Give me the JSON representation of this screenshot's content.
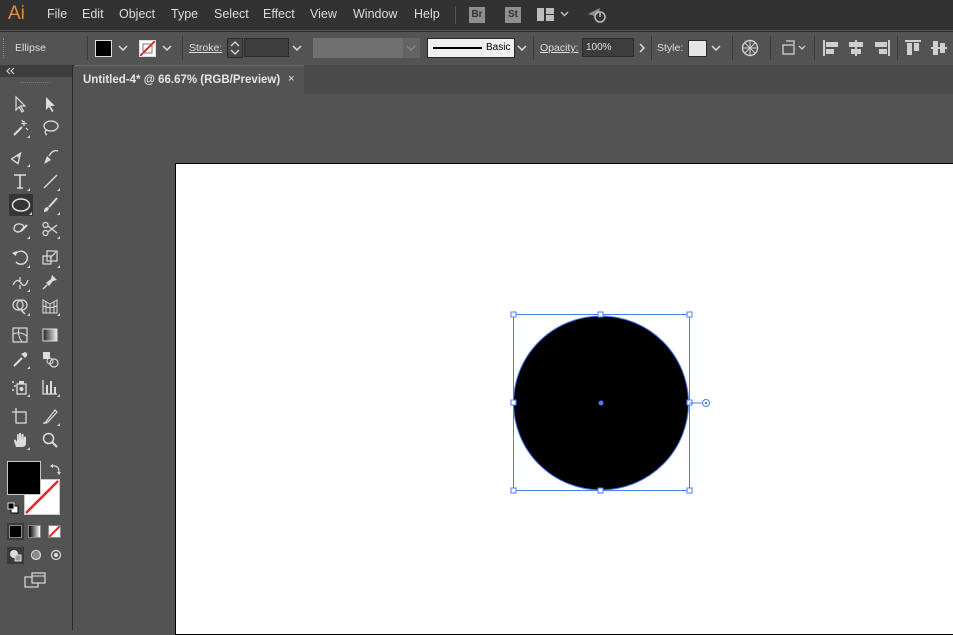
{
  "app": {
    "logo": "Ai"
  },
  "menu": [
    "File",
    "Edit",
    "Object",
    "Type",
    "Select",
    "Effect",
    "View",
    "Window",
    "Help"
  ],
  "app_buttons": {
    "bridge": "Br",
    "stock": "St"
  },
  "control_bar": {
    "object_type": "Ellipse",
    "stroke_label": "Stroke:",
    "brush_label": "Basic",
    "opacity_label": "Opacity:",
    "opacity_value": "100%",
    "style_label": "Style:"
  },
  "document_tab": {
    "title": "Untitled-4* @ 66.67% (RGB/Preview)",
    "close": "×"
  },
  "colors": {
    "selection": "#4b7bf5",
    "fill": "#000000",
    "stroke_none_slash": "#e0262b",
    "app_logo": "#e48e3c"
  },
  "tools": [
    "selection-tool",
    "direct-selection-tool",
    "magic-wand-tool",
    "lasso-tool",
    "pen-tool",
    "curvature-tool",
    "type-tool",
    "line-segment-tool",
    "ellipse-tool",
    "paintbrush-tool",
    "shaper-tool",
    "scissors-tool",
    "rotate-tool",
    "scale-tool",
    "width-tool",
    "puppet-warp-tool",
    "shape-builder-tool",
    "perspective-grid-tool",
    "mesh-tool",
    "gradient-tool",
    "eyedropper-tool",
    "blend-tool",
    "symbol-sprayer-tool",
    "column-graph-tool",
    "artboard-tool",
    "slice-tool",
    "hand-tool",
    "zoom-tool"
  ]
}
